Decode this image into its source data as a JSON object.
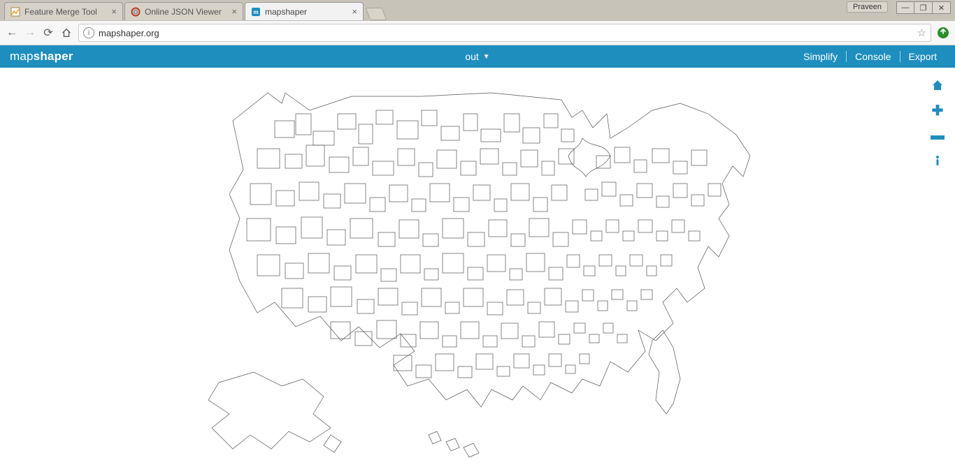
{
  "browser": {
    "tabs": [
      {
        "title": "Feature Merge Tool",
        "active": false
      },
      {
        "title": "Online JSON Viewer",
        "active": false
      },
      {
        "title": "mapshaper",
        "active": true
      }
    ],
    "user_label": "Praveen",
    "address": "mapshaper.org"
  },
  "app": {
    "logo_prefix": "map",
    "logo_bold": "shaper",
    "layer_name": "out",
    "menu": {
      "simplify": "Simplify",
      "console": "Console",
      "export": "Export"
    },
    "tools": {
      "home": "home-icon",
      "zoom_in": "zoom-in-icon",
      "zoom_out": "zoom-out-icon",
      "info": "info-icon"
    }
  }
}
